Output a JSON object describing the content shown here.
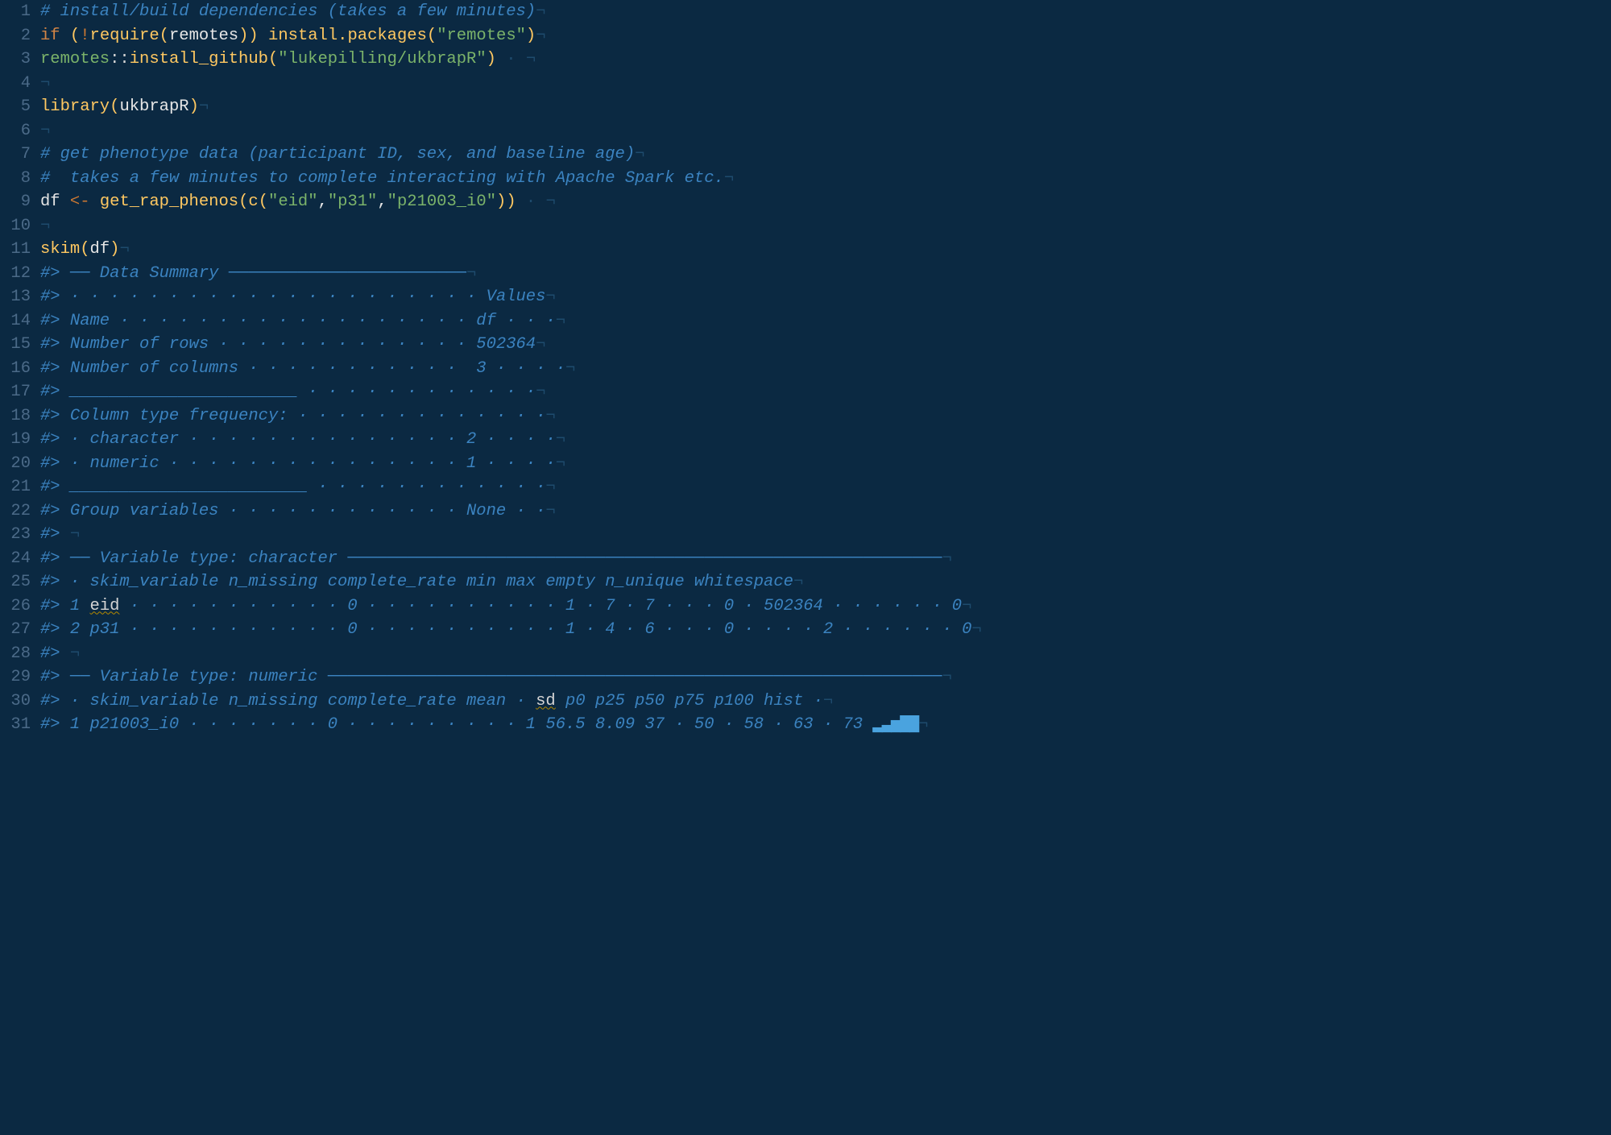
{
  "lineCount": 31,
  "tokens": {
    "l1": [
      [
        "comment",
        "# install/build dependencies (takes a few minutes)"
      ],
      [
        "eol",
        "¬"
      ]
    ],
    "l2": [
      [
        "keyword",
        "if"
      ],
      [
        "ws",
        " "
      ],
      [
        "paren",
        "("
      ],
      [
        "bang",
        "!"
      ],
      [
        "func",
        "require"
      ],
      [
        "paren",
        "("
      ],
      [
        "ident",
        "remotes"
      ],
      [
        "paren",
        ")"
      ],
      [
        "paren",
        ")"
      ],
      [
        "ws",
        " "
      ],
      [
        "func",
        "install.packages"
      ],
      [
        "paren",
        "("
      ],
      [
        "string",
        "\"remotes\""
      ],
      [
        "paren",
        ")"
      ],
      [
        "eol",
        "¬"
      ]
    ],
    "l3": [
      [
        "ns",
        "remotes"
      ],
      [
        "nsop",
        "::"
      ],
      [
        "func",
        "install_github"
      ],
      [
        "paren",
        "("
      ],
      [
        "string",
        "\"lukepilling/ukbrapR\""
      ],
      [
        "paren",
        ")"
      ],
      [
        "ws",
        " · "
      ],
      [
        "eol",
        "¬"
      ]
    ],
    "l4": [
      [
        "eol",
        "¬"
      ]
    ],
    "l5": [
      [
        "func",
        "library"
      ],
      [
        "paren",
        "("
      ],
      [
        "ident",
        "ukbrapR"
      ],
      [
        "paren",
        ")"
      ],
      [
        "eol",
        "¬"
      ]
    ],
    "l6": [
      [
        "eol",
        "¬"
      ]
    ],
    "l7": [
      [
        "comment",
        "# get phenotype data (participant ID, sex, and baseline age)"
      ],
      [
        "eol",
        "¬"
      ]
    ],
    "l8": [
      [
        "comment",
        "#  takes a few minutes to complete interacting with Apache Spark etc."
      ],
      [
        "eol",
        "¬"
      ]
    ],
    "l9": [
      [
        "ident",
        "df"
      ],
      [
        "ws",
        " "
      ],
      [
        "op",
        "<-"
      ],
      [
        "ws",
        " "
      ],
      [
        "func",
        "get_rap_phenos"
      ],
      [
        "paren",
        "("
      ],
      [
        "func",
        "c"
      ],
      [
        "paren",
        "("
      ],
      [
        "string",
        "\"eid\""
      ],
      [
        "ident",
        ","
      ],
      [
        "string",
        "\"p31\""
      ],
      [
        "ident",
        ","
      ],
      [
        "string",
        "\"p21003_i0\""
      ],
      [
        "paren",
        ")"
      ],
      [
        "paren",
        ")"
      ],
      [
        "ws",
        " · "
      ],
      [
        "eol",
        "¬"
      ]
    ],
    "l10": [
      [
        "eol",
        "¬"
      ]
    ],
    "l11": [
      [
        "func",
        "skim"
      ],
      [
        "paren",
        "("
      ],
      [
        "ident",
        "df"
      ],
      [
        "paren",
        ")"
      ],
      [
        "eol",
        "¬"
      ]
    ],
    "l12": [
      [
        "comment",
        "#> ── Data Summary ────────────────────────"
      ],
      [
        "eol",
        "¬"
      ]
    ],
    "l13": [
      [
        "comment",
        "#> · · · · · · · · · · · · · · · · · · · · · Values"
      ],
      [
        "eol",
        "¬"
      ]
    ],
    "l14": [
      [
        "comment",
        "#> Name · · · · · · · · · · · · · · · · · · df · · ·"
      ],
      [
        "eol",
        "¬"
      ]
    ],
    "l15": [
      [
        "comment",
        "#> Number of rows · · · · · · · · · · · · · 502364"
      ],
      [
        "eol",
        "¬"
      ]
    ],
    "l16": [
      [
        "comment",
        "#> Number of columns · · · · · · · · · · ·  3 · · · ·"
      ],
      [
        "eol",
        "¬"
      ]
    ],
    "l17": [
      [
        "comment",
        "#> _______________________ · · · · · · · · · · · ·"
      ],
      [
        "eol",
        "¬"
      ]
    ],
    "l18": [
      [
        "comment",
        "#> Column type frequency: · · · · · · · · · · · · ·"
      ],
      [
        "eol",
        "¬"
      ]
    ],
    "l19": [
      [
        "comment",
        "#> · character · · · · · · · · · · · · · · 2 · · · ·"
      ],
      [
        "eol",
        "¬"
      ]
    ],
    "l20": [
      [
        "comment",
        "#> · numeric · · · · · · · · · · · · · · · 1 · · · ·"
      ],
      [
        "eol",
        "¬"
      ]
    ],
    "l21": [
      [
        "comment",
        "#> ________________________ · · · · · · · · · · · ·"
      ],
      [
        "eol",
        "¬"
      ]
    ],
    "l22": [
      [
        "comment",
        "#> Group variables · · · · · · · · · · · · None · ·"
      ],
      [
        "eol",
        "¬"
      ]
    ],
    "l23": [
      [
        "comment",
        "#> "
      ],
      [
        "eol",
        "¬"
      ]
    ],
    "l24": [
      [
        "comment",
        "#> ── Variable type: character ────────────────────────────────────────────────────────────"
      ],
      [
        "eol",
        "¬"
      ]
    ],
    "l25": [
      [
        "comment",
        "#> · skim_variable n_missing complete_rate min max empty n_unique whitespace"
      ],
      [
        "eol",
        "¬"
      ]
    ],
    "l26": [
      [
        "comment",
        "#> 1 "
      ],
      [
        "spell",
        "eid"
      ],
      [
        "comment",
        " · · · · · · · · · · · 0 · · · · · · · · · · 1 · 7 · 7 · · · 0 · 502364 · · · · · · 0"
      ],
      [
        "eol",
        "¬"
      ]
    ],
    "l27": [
      [
        "comment",
        "#> 2 p31 · · · · · · · · · · · 0 · · · · · · · · · · 1 · 4 · 6 · · · 0 · · · · 2 · · · · · · 0"
      ],
      [
        "eol",
        "¬"
      ]
    ],
    "l28": [
      [
        "comment",
        "#> "
      ],
      [
        "eol",
        "¬"
      ]
    ],
    "l29": [
      [
        "comment",
        "#> ── Variable type: numeric ──────────────────────────────────────────────────────────────"
      ],
      [
        "eol",
        "¬"
      ]
    ],
    "l30": [
      [
        "comment",
        "#> · skim_variable n_missing complete_rate mean · "
      ],
      [
        "spell",
        "sd"
      ],
      [
        "comment",
        " p0 p25 p50 p75 p100 hist ·"
      ],
      [
        "eol",
        "¬"
      ]
    ],
    "l31": [
      [
        "comment",
        "#> 1 p21003_i0 · · · · · · · 0 · · · · · · · · · 1 56.5 8.09 37 · 50 · 58 · 63 · 73 "
      ],
      [
        "hist",
        "▂▃▅▇▇"
      ],
      [
        "eol",
        "¬"
      ]
    ]
  },
  "chart_data": {
    "type": "table",
    "title": "Data Summary",
    "summary": {
      "Name": "df",
      "Number of rows": 502364,
      "Number of columns": 3,
      "Column type frequency": {
        "character": 2,
        "numeric": 1
      },
      "Group variables": "None"
    },
    "character_vars": {
      "columns": [
        "skim_variable",
        "n_missing",
        "complete_rate",
        "min",
        "max",
        "empty",
        "n_unique",
        "whitespace"
      ],
      "rows": [
        [
          "eid",
          0,
          1,
          7,
          7,
          0,
          502364,
          0
        ],
        [
          "p31",
          0,
          1,
          4,
          6,
          0,
          2,
          0
        ]
      ]
    },
    "numeric_vars": {
      "columns": [
        "skim_variable",
        "n_missing",
        "complete_rate",
        "mean",
        "sd",
        "p0",
        "p25",
        "p50",
        "p75",
        "p100",
        "hist"
      ],
      "rows": [
        [
          "p21003_i0",
          0,
          1,
          56.5,
          8.09,
          37,
          50,
          58,
          63,
          73,
          "▂▃▅▇▇"
        ]
      ]
    }
  }
}
